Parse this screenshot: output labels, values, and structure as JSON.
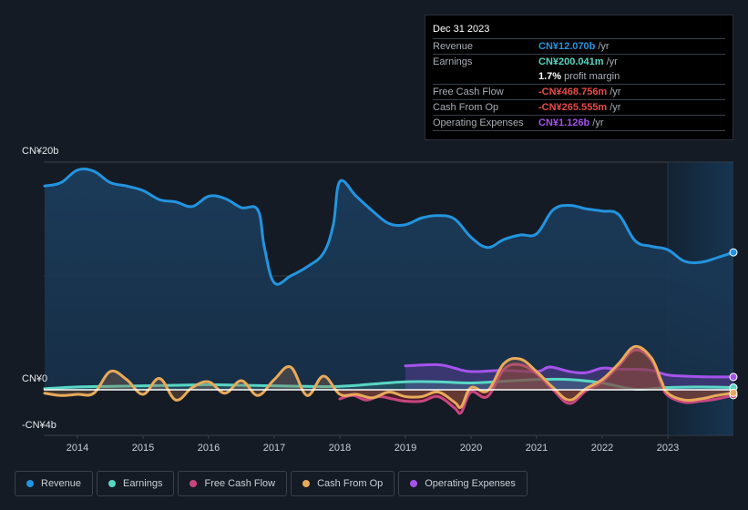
{
  "tooltip": {
    "date": "Dec 31 2023",
    "rows": [
      {
        "label": "Revenue",
        "value": "CN¥12.070b",
        "unit": "/yr",
        "color": "#2394df"
      },
      {
        "label": "Earnings",
        "value": "CN¥200.041m",
        "unit": "/yr",
        "color": "#58d7c4"
      },
      {
        "label": "",
        "margin_value": "1.7%",
        "margin_text": "profit margin"
      },
      {
        "label": "Free Cash Flow",
        "value": "-CN¥468.756m",
        "unit": "/yr",
        "color": "#e84a4a"
      },
      {
        "label": "Cash From Op",
        "value": "-CN¥265.555m",
        "unit": "/yr",
        "color": "#e84a4a"
      },
      {
        "label": "Operating Expenses",
        "value": "CN¥1.126b",
        "unit": "/yr",
        "color": "#a553ec"
      }
    ]
  },
  "legend": [
    {
      "label": "Revenue",
      "color": "#2394df"
    },
    {
      "label": "Earnings",
      "color": "#58d7c4"
    },
    {
      "label": "Free Cash Flow",
      "color": "#c7467f"
    },
    {
      "label": "Cash From Op",
      "color": "#e8aa5a"
    },
    {
      "label": "Operating Expenses",
      "color": "#a553ec"
    }
  ],
  "chart_data": {
    "type": "area",
    "title": "",
    "xlabel": "",
    "ylabel": "",
    "y_tick_labels": [
      "CN¥20b",
      "CN¥0",
      "-CN¥4b"
    ],
    "y_ticks": [
      20,
      0,
      -4
    ],
    "ylim": [
      -4,
      20
    ],
    "xlim": [
      2013.5,
      2024.0
    ],
    "x_tick_labels": [
      "2014",
      "2015",
      "2016",
      "2017",
      "2018",
      "2019",
      "2020",
      "2021",
      "2022",
      "2023"
    ],
    "x_ticks": [
      2014,
      2015,
      2016,
      2017,
      2018,
      2019,
      2020,
      2021,
      2022,
      2023
    ],
    "grid": true,
    "forecast_shading_start": 2023.0,
    "series": [
      {
        "name": "Revenue",
        "color": "#2394df",
        "x": [
          2013.5,
          2013.75,
          2014.0,
          2014.25,
          2014.5,
          2014.75,
          2015.0,
          2015.25,
          2015.5,
          2015.75,
          2016.0,
          2016.25,
          2016.5,
          2016.75,
          2016.85,
          2017.0,
          2017.25,
          2017.5,
          2017.75,
          2017.9,
          2018.0,
          2018.25,
          2018.5,
          2018.75,
          2019.0,
          2019.25,
          2019.5,
          2019.75,
          2020.0,
          2020.25,
          2020.5,
          2020.75,
          2021.0,
          2021.25,
          2021.5,
          2021.75,
          2022.0,
          2022.25,
          2022.5,
          2022.75,
          2023.0,
          2023.25,
          2023.5,
          2023.75,
          2024.0
        ],
        "values": [
          17.9,
          18.2,
          19.3,
          19.2,
          18.2,
          17.9,
          17.5,
          16.7,
          16.5,
          16.1,
          17.0,
          16.8,
          16.0,
          15.8,
          12.5,
          9.4,
          10.0,
          10.8,
          12.0,
          14.5,
          18.3,
          17.0,
          15.7,
          14.6,
          14.5,
          15.1,
          15.3,
          15.0,
          13.4,
          12.5,
          13.2,
          13.6,
          13.7,
          15.8,
          16.2,
          15.9,
          15.7,
          15.4,
          13.1,
          12.6,
          12.3,
          11.3,
          11.2,
          11.6,
          12.07
        ]
      },
      {
        "name": "Earnings",
        "color": "#58d7c4",
        "x": [
          2013.5,
          2014.0,
          2014.5,
          2015.0,
          2015.5,
          2016.0,
          2016.5,
          2017.0,
          2017.5,
          2018.0,
          2018.5,
          2019.0,
          2019.5,
          2020.0,
          2020.5,
          2021.0,
          2021.5,
          2022.0,
          2022.5,
          2023.0,
          2023.5,
          2024.0
        ],
        "values": [
          0.1,
          0.25,
          0.3,
          0.35,
          0.4,
          0.45,
          0.4,
          0.35,
          0.3,
          0.3,
          0.5,
          0.7,
          0.7,
          0.6,
          0.75,
          0.9,
          0.9,
          0.6,
          0.05,
          0.2,
          0.25,
          0.2
        ]
      },
      {
        "name": "Free Cash Flow",
        "color": "#c7467f",
        "x": [
          2018.0,
          2018.2,
          2018.4,
          2018.6,
          2018.8,
          2019.0,
          2019.25,
          2019.5,
          2019.75,
          2019.85,
          2020.0,
          2020.25,
          2020.5,
          2020.75,
          2021.0,
          2021.25,
          2021.5,
          2021.75,
          2022.0,
          2022.25,
          2022.5,
          2022.75,
          2022.9,
          2023.0,
          2023.25,
          2023.5,
          2023.75,
          2024.0
        ],
        "values": [
          -0.8,
          -0.5,
          -0.9,
          -0.6,
          -0.8,
          -1.0,
          -1.0,
          -0.6,
          -1.6,
          -2.0,
          -0.2,
          -0.6,
          1.8,
          2.2,
          1.4,
          0.0,
          -1.2,
          -0.1,
          0.7,
          2.1,
          3.5,
          2.6,
          0.5,
          -0.5,
          -1.1,
          -1.0,
          -0.8,
          -0.47
        ]
      },
      {
        "name": "Cash From Op",
        "color": "#e8aa5a",
        "x": [
          2013.5,
          2013.75,
          2014.0,
          2014.25,
          2014.5,
          2014.75,
          2015.0,
          2015.25,
          2015.5,
          2015.75,
          2016.0,
          2016.25,
          2016.5,
          2016.75,
          2017.0,
          2017.25,
          2017.5,
          2017.75,
          2018.0,
          2018.25,
          2018.5,
          2018.75,
          2019.0,
          2019.25,
          2019.5,
          2019.75,
          2019.85,
          2020.0,
          2020.25,
          2020.5,
          2020.75,
          2021.0,
          2021.25,
          2021.5,
          2021.75,
          2022.0,
          2022.25,
          2022.5,
          2022.75,
          2022.9,
          2023.0,
          2023.25,
          2023.5,
          2023.75,
          2024.0
        ],
        "values": [
          -0.3,
          -0.5,
          -0.4,
          -0.3,
          1.6,
          0.9,
          -0.4,
          1.0,
          -0.9,
          0.2,
          0.7,
          -0.3,
          0.8,
          -0.5,
          0.9,
          2.0,
          -0.5,
          1.2,
          -0.4,
          -0.4,
          -0.7,
          -0.2,
          -0.6,
          -0.6,
          -0.2,
          -1.1,
          -1.5,
          0.2,
          -0.1,
          2.3,
          2.7,
          1.6,
          0.2,
          -0.9,
          0.1,
          0.9,
          2.3,
          3.8,
          2.8,
          0.8,
          -0.3,
          -0.9,
          -0.8,
          -0.5,
          -0.27
        ]
      },
      {
        "name": "Operating Expenses",
        "color": "#a553ec",
        "x": [
          2019.0,
          2019.5,
          2019.75,
          2020.0,
          2020.5,
          2021.0,
          2021.2,
          2021.5,
          2021.75,
          2022.0,
          2022.25,
          2022.5,
          2022.75,
          2023.0,
          2023.25,
          2023.5,
          2023.75,
          2024.0
        ],
        "values": [
          2.1,
          2.2,
          1.9,
          1.6,
          1.7,
          1.6,
          2.0,
          1.6,
          1.5,
          1.9,
          1.8,
          1.8,
          1.7,
          1.3,
          1.2,
          1.15,
          1.13,
          1.126
        ]
      }
    ]
  }
}
